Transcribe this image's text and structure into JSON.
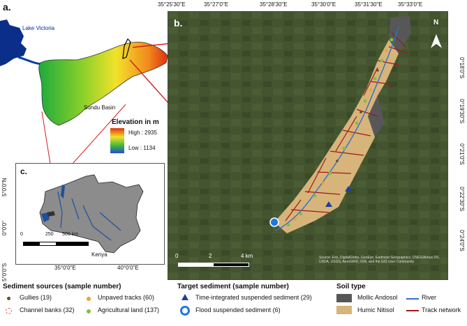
{
  "panel_a": {
    "letter": "a.",
    "lake_label": "Lake Victoria",
    "basin_label": "Sondu Basin",
    "elevation_title": "Elevation in m",
    "high_label": "High : 2935",
    "low_label": "Low : 1134",
    "colors": {
      "lake": "#0a2e8a",
      "high": "#e03010",
      "mid": "#f2e22a",
      "low": "#1cab3c",
      "water": "#0b3fa0"
    }
  },
  "panel_c": {
    "letter": "c.",
    "y_ticks": [
      "5°0'0\"N",
      "0°0'0\"",
      "5°0'0\"S"
    ],
    "x_ticks": [
      "35°0'0\"E",
      "40°0'0\"E"
    ],
    "scale_ticks": [
      "0",
      "250",
      "500 km"
    ],
    "country_label": "Kenya"
  },
  "panel_b": {
    "letter": "b.",
    "top_ticks": [
      "35°25'30\"E",
      "35°27'0\"E",
      "35°28'30\"E",
      "35°30'0\"E",
      "35°31'30\"E",
      "35°33'0\"E"
    ],
    "right_ticks": [
      "0°18'0\"S",
      "0°19'30\"S",
      "0°21'0\"S",
      "0°22'30\"S",
      "0°24'0\"S"
    ],
    "scale_ticks": [
      "0",
      "2",
      "4 km"
    ],
    "north_label": "N",
    "attribution": "Source: Esri, DigitalGlobe, GeoEye, Earthstar Geographics, CNES/Airbus DS, USDA, USGS, AeroGRID, IGN, and the GIS User Community"
  },
  "legend": {
    "sediment_sources": {
      "title": "Sediment sources (sample number)",
      "items": [
        {
          "label": "Gullies (19)",
          "color": "#6b4a1e"
        },
        {
          "label": "Channel banks (32)",
          "color": "#e05555"
        },
        {
          "label": "Unpaved tracks (60)",
          "color": "#e8a43a"
        },
        {
          "label": "Agricultural land (137)",
          "color": "#7cc23a"
        }
      ]
    },
    "target_sediment": {
      "title": "Target sediment (sample number)",
      "items": [
        {
          "label": "Time-integrated suspended sediment (29)",
          "color": "#1f3f9a"
        },
        {
          "label": "Flood suspended sediment (6)",
          "color": "#1e78e0"
        }
      ]
    },
    "soil_type": {
      "title": "Soil type",
      "items": [
        {
          "label": "Mollic Andosol",
          "color": "#575757"
        },
        {
          "label": "Humic Nitisol",
          "color": "#d7b47a"
        },
        {
          "label": "River",
          "color": "#2f6fd0"
        },
        {
          "label": "Track network",
          "color": "#a01818"
        }
      ]
    }
  }
}
